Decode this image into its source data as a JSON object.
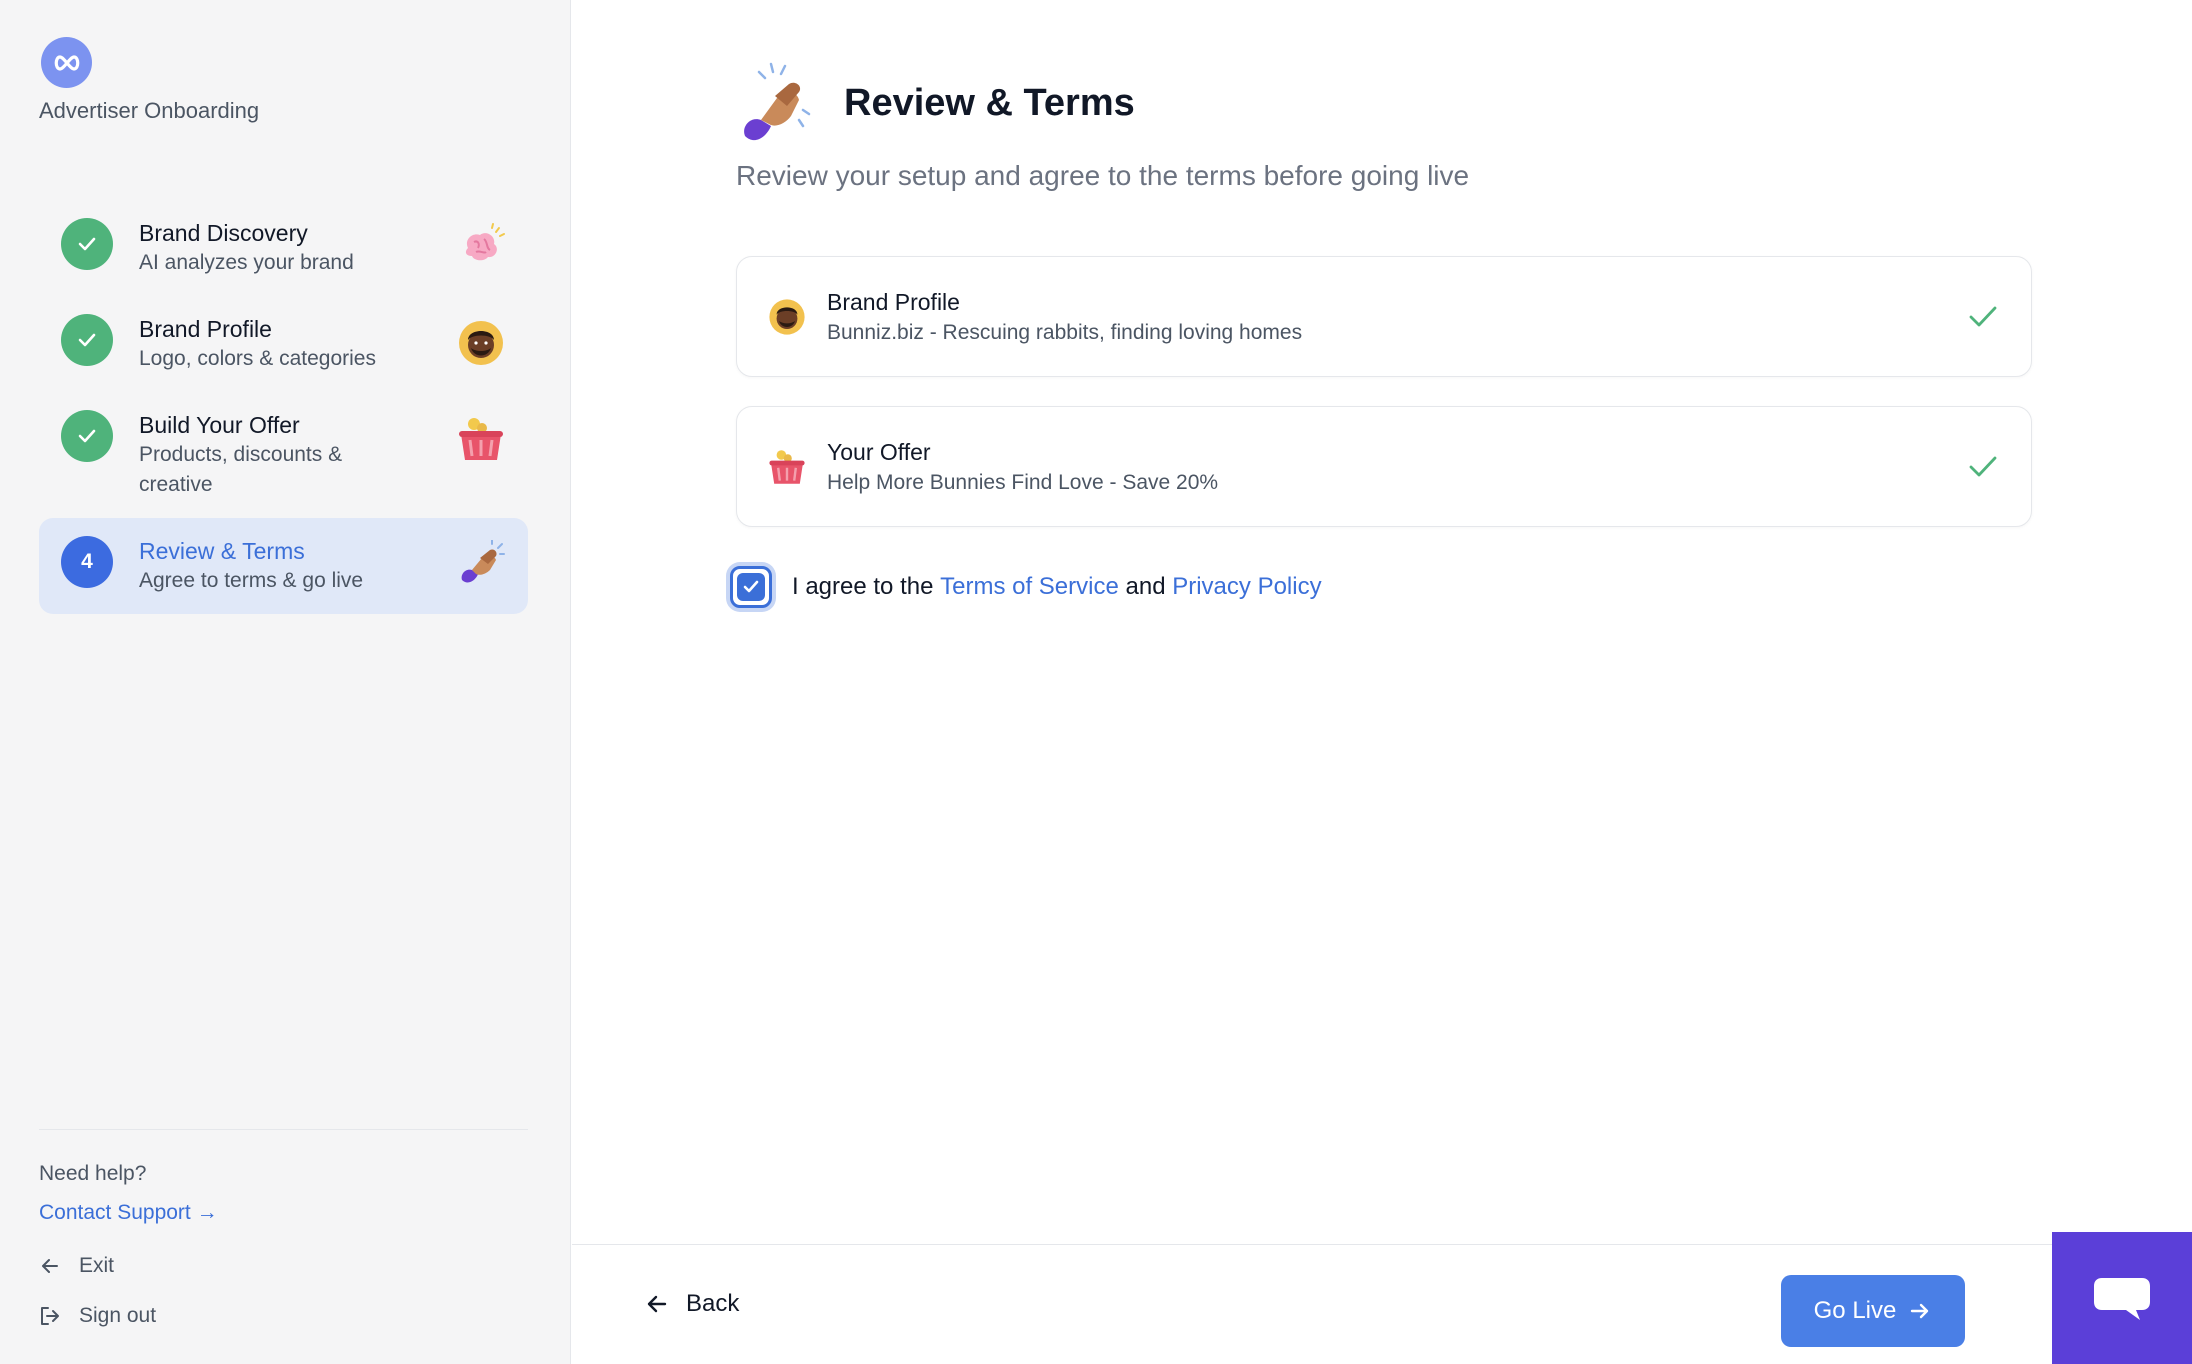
{
  "sidebar": {
    "app_subtitle": "Advertiser Onboarding",
    "steps": [
      {
        "title": "Brand Discovery",
        "description": "AI analyzes your brand",
        "status": "done",
        "icon": "brain-icon"
      },
      {
        "title": "Brand Profile",
        "description": "Logo, colors & categories",
        "status": "done",
        "icon": "avatar-icon"
      },
      {
        "title": "Build Your Offer",
        "description": "Products, discounts & creative",
        "status": "done",
        "icon": "basket-icon"
      },
      {
        "title": "Review & Terms",
        "description": "Agree to terms & go live",
        "status": "current",
        "number": "4",
        "icon": "handshake-icon"
      }
    ],
    "help_label": "Need help?",
    "contact_support": "Contact Support →",
    "exit_label": "Exit",
    "signout_label": "Sign out"
  },
  "main": {
    "title": "Review & Terms",
    "subtitle": "Review your setup and agree to the terms before going live",
    "cards": [
      {
        "title": "Brand Profile",
        "description": "Bunniz.biz - Rescuing rabbits, finding loving homes",
        "icon": "avatar-icon"
      },
      {
        "title": "Your Offer",
        "description": "Help More Bunnies Find Love - Save 20%",
        "icon": "basket-icon"
      }
    ],
    "agree": {
      "prefix": "I agree to the",
      "terms_link": "Terms of Service",
      "and": "and",
      "privacy_link": "Privacy Policy",
      "checked": true
    },
    "back_label": "Back",
    "go_live_label": "Go Live"
  },
  "colors": {
    "accent": "#3b6fd8",
    "success": "#4fb37b",
    "chat": "#5b3fd8"
  }
}
